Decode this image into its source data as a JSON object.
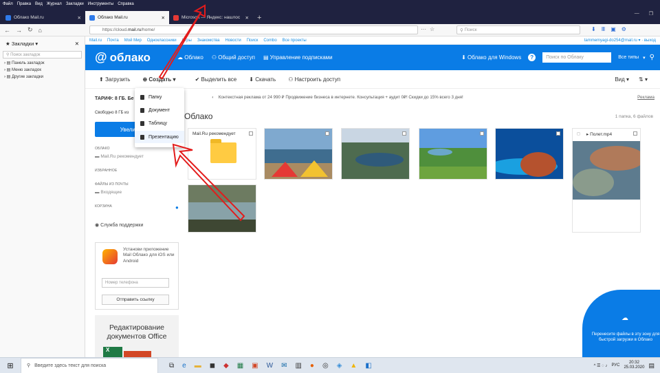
{
  "browser": {
    "menu": [
      "Файл",
      "Правка",
      "Вид",
      "Журнал",
      "Закладки",
      "Инструменты",
      "Справка"
    ],
    "tabs": [
      {
        "title": "Облако Mail.ru",
        "active": false
      },
      {
        "title": "Облако Mail.ru",
        "active": true
      },
      {
        "title": "Microsoft — Яндекс: нашлос",
        "active": false
      }
    ],
    "url_prefix": "https://cloud.",
    "url_host": "mail.ru",
    "url_path": "/home/",
    "search_placeholder": "Поиск"
  },
  "bookmarks": {
    "title": "Закладки",
    "search_placeholder": "Поиск закладок",
    "items": [
      "Панель закладок",
      "Меню закладок",
      "Другие закладки"
    ]
  },
  "portal": {
    "links": [
      "Mail.ru",
      "Почта",
      "Мой Мир",
      "Одноклассники",
      "Игры",
      "Знакомства",
      "Новости",
      "Поиск",
      "Combo",
      "Все проекты"
    ],
    "user": "tammemyagi-do254@mail.ru",
    "logout": "выход"
  },
  "header": {
    "logo": "облако",
    "nav": [
      "Облако",
      "Общий доступ",
      "Управление подписками"
    ],
    "windows_app": "Облако для Windows",
    "search_placeholder": "Поиск по Облаку",
    "all_types": "Все типы"
  },
  "toolbar": {
    "upload": "Загрузить",
    "create": "Создать",
    "select_all": "Выделить все",
    "download": "Скачать",
    "share": "Настроить доступ",
    "view": "Вид"
  },
  "create_menu": [
    "Папку",
    "Документ",
    "Таблицу",
    "Презентацию"
  ],
  "left": {
    "tariff": "ТАРИФ: 8 ГБ. Бе",
    "free": "Свободно 8 ГБ из",
    "increase": "Увеличит",
    "sections": [
      {
        "label": "ОБЛАКО",
        "items": [
          "Mail.Ru рекомендует"
        ]
      },
      {
        "label": "ИЗБРАННОЕ",
        "items": []
      },
      {
        "label": "ФАЙЛЫ ИЗ ПОЧТЫ",
        "items": [
          "Входящие"
        ]
      },
      {
        "label": "КОРЗИНА",
        "items": []
      }
    ],
    "support": "Служба поддержки",
    "promo_text": "Установи приложение Mail Облако для iOS или Android",
    "phone_placeholder": "Номер телефона",
    "send_link": "Отправить ссылку",
    "office_title": "Редактирование документов Office"
  },
  "ads": {
    "text": "Контекстная реклама от 24 990 ₽   Продвижение бизнеса в интернете. Консультация + аудит 0₽! Скидки до 15% всего 3 дня!",
    "label": "Реклама"
  },
  "content": {
    "title": "Облако",
    "count": "1 папка, 6 файлов",
    "items": [
      {
        "type": "folder",
        "name": "Mail.Ru рекомендует"
      },
      {
        "type": "image",
        "name": "camp",
        "colors": [
          "#7fa9cf",
          "#3f6d8f",
          "#a98b62"
        ]
      },
      {
        "type": "image",
        "name": "lake",
        "colors": [
          "#c9d6e3",
          "#4e6b4f",
          "#2f5a7a"
        ]
      },
      {
        "type": "image",
        "name": "steppe",
        "colors": [
          "#5f9de0",
          "#4f8f3c",
          "#6ea53f"
        ]
      },
      {
        "type": "image",
        "name": "fort",
        "colors": [
          "#0b4f9c",
          "#1aa0e0",
          "#b5522e"
        ]
      },
      {
        "type": "video",
        "name": "Полет.mp4"
      },
      {
        "type": "image",
        "name": "canyon",
        "colors": [
          "#6d7b61",
          "#88a2a8",
          "#3e4733"
        ]
      }
    ]
  },
  "dropzone": {
    "text": "Перенесите файлы в эту зону для быстрой загрузки в Облако"
  },
  "taskbar": {
    "search": "Введите здесь текст для поиска",
    "lang": "РУС",
    "time": "20:32",
    "date": "25.03.2020"
  }
}
